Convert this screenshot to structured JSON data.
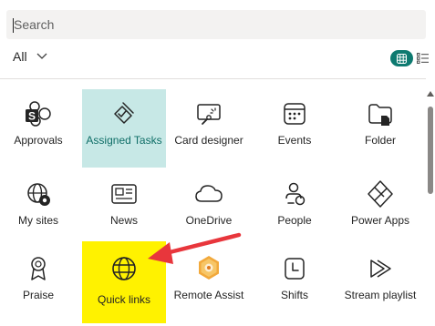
{
  "search": {
    "placeholder": "Search",
    "value": ""
  },
  "filter": {
    "label": "All",
    "icon": "chevron-down-icon"
  },
  "view_toggle": {
    "grid_icon": "grid-view-icon",
    "list_icon": "list-view-icon",
    "active": "grid",
    "accent": "#0e7a70"
  },
  "tiles": [
    {
      "label": "Approvals",
      "icon": "approvals-icon",
      "state": "normal"
    },
    {
      "label": "Assigned Tasks",
      "icon": "assigned-tasks-icon",
      "state": "selected"
    },
    {
      "label": "Card designer",
      "icon": "card-designer-icon",
      "state": "normal"
    },
    {
      "label": "Events",
      "icon": "calendar-icon",
      "state": "normal"
    },
    {
      "label": "Folder",
      "icon": "folder-icon",
      "state": "normal"
    },
    {
      "label": "My sites",
      "icon": "globe-settings-icon",
      "state": "normal"
    },
    {
      "label": "News",
      "icon": "news-icon",
      "state": "normal"
    },
    {
      "label": "OneDrive",
      "icon": "cloud-icon",
      "state": "normal"
    },
    {
      "label": "People",
      "icon": "people-icon",
      "state": "normal"
    },
    {
      "label": "Power Apps",
      "icon": "power-apps-icon",
      "state": "normal"
    },
    {
      "label": "Praise",
      "icon": "ribbon-icon",
      "state": "normal"
    },
    {
      "label": "Quick links",
      "icon": "globe-icon",
      "state": "highlighted"
    },
    {
      "label": "Remote Assist",
      "icon": "remote-assist-icon",
      "state": "normal"
    },
    {
      "label": "Shifts",
      "icon": "clock-icon",
      "state": "normal"
    },
    {
      "label": "Stream playlist",
      "icon": "stream-icon",
      "state": "normal"
    }
  ],
  "colors": {
    "selected_bg": "#c7e8e6",
    "highlight_bg": "#fff200",
    "annotation_arrow": "#e8363c"
  }
}
